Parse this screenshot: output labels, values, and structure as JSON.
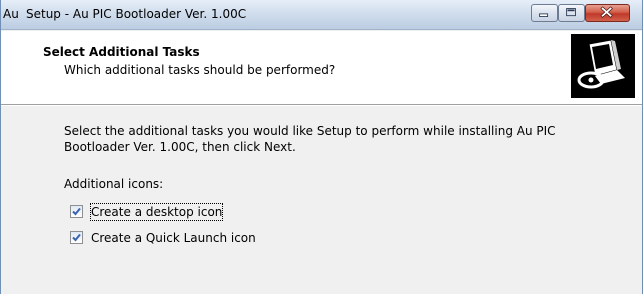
{
  "window": {
    "app_icon_text": "Au",
    "title": "Setup - Au PIC Bootloader Ver. 1.00C"
  },
  "header": {
    "title": "Select Additional Tasks",
    "subtitle": "Which additional tasks should be performed?",
    "logo_icon": "computer-disk-icon"
  },
  "body": {
    "description": "Select the additional tasks you would like Setup to perform while installing Au PIC Bootloader Ver. 1.00C, then click Next.",
    "section_label": "Additional icons:"
  },
  "tasks": [
    {
      "label": "Create a desktop icon",
      "checked": true
    },
    {
      "label": "Create a Quick Launch icon",
      "checked": true
    }
  ],
  "colors": {
    "checkmark": "#3a63b0",
    "close_button": "#c0382a"
  }
}
